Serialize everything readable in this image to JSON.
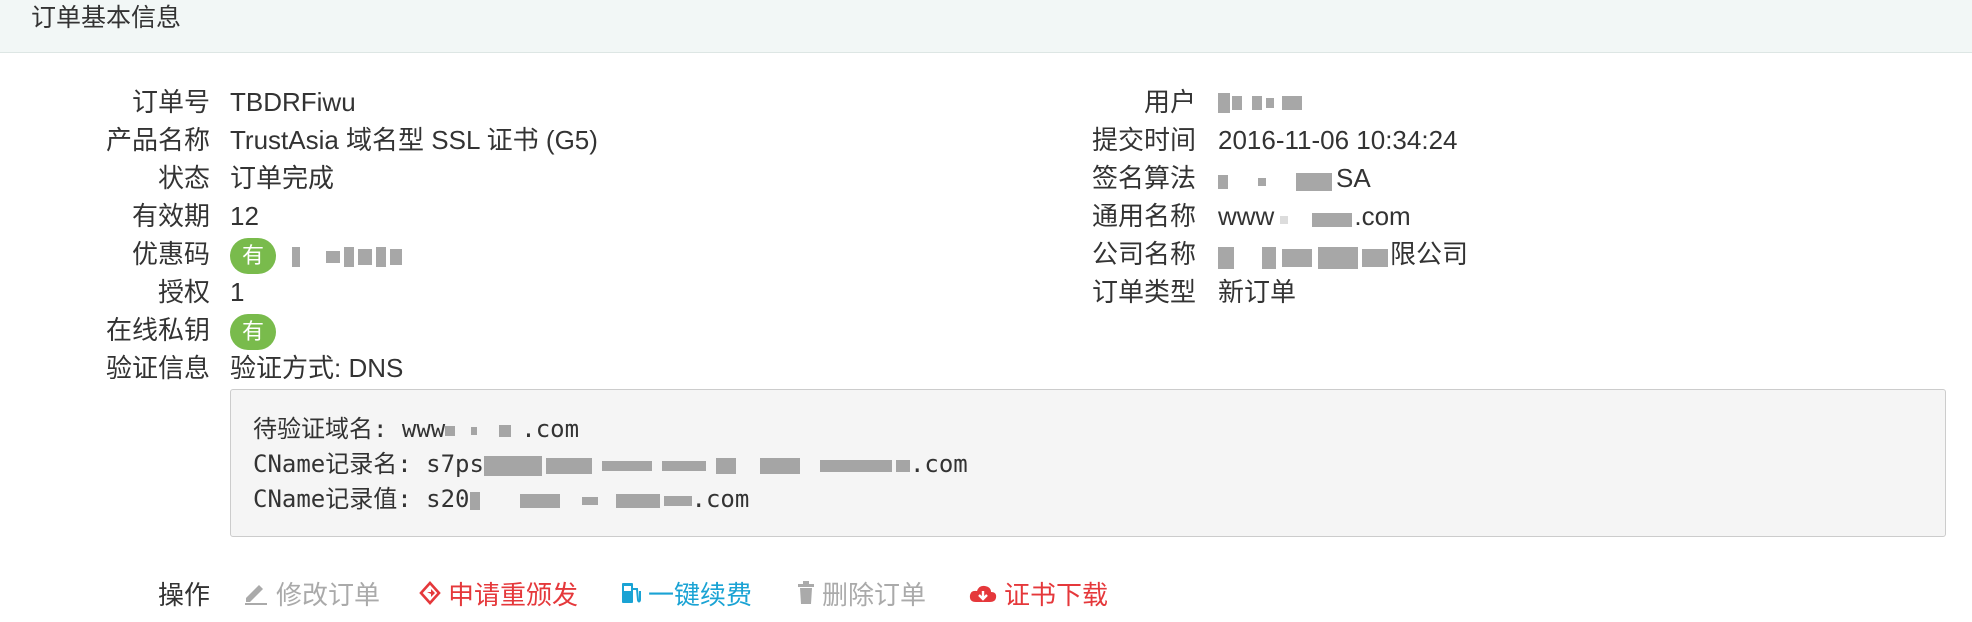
{
  "panel": {
    "title": "订单基本信息"
  },
  "left_fields": {
    "order_no": {
      "label": "订单号",
      "value": "TBDRFiwu"
    },
    "product": {
      "label": "产品名称",
      "value": "TrustAsia 域名型 SSL 证书 (G5)"
    },
    "status": {
      "label": "状态",
      "value": "订单完成"
    },
    "validity": {
      "label": "有效期",
      "value": "12"
    },
    "coupon": {
      "label": "优惠码",
      "badge": "有"
    },
    "license": {
      "label": "授权",
      "value": "1"
    },
    "online_key": {
      "label": "在线私钥",
      "badge": "有"
    },
    "verify": {
      "label": "验证信息",
      "value": "验证方式: DNS"
    }
  },
  "right_fields": {
    "user": {
      "label": "用户"
    },
    "submit_time": {
      "label": "提交时间",
      "value": "2016-11-06 10:34:24"
    },
    "sign_algo": {
      "label": "签名算法",
      "value_suffix": "SA"
    },
    "common_name": {
      "label": "通用名称",
      "value_prefix": "www",
      "value_suffix": ".com"
    },
    "company": {
      "label": "公司名称",
      "value_suffix": "限公司"
    },
    "order_type": {
      "label": "订单类型",
      "value": "新订单"
    }
  },
  "verification_box": {
    "domain_label": "待验证域名: ",
    "domain_prefix": "www",
    "domain_suffix": ".com",
    "cname_name_label": "CName记录名: ",
    "cname_name_prefix": "s7ps",
    "cname_name_suffix": ".com",
    "cname_value_label": "CName记录值: ",
    "cname_value_prefix": "s20",
    "cname_value_suffix": ".com"
  },
  "actions": {
    "label": "操作",
    "edit": "修改订单",
    "reissue": "申请重颁发",
    "renew": "一键续费",
    "delete": "删除订单",
    "download": "证书下载"
  },
  "colors": {
    "badge_green": "#79bb4c",
    "action_disabled": "#aaaaaa",
    "action_red": "#e5383b",
    "action_blue": "#1aa3d4"
  },
  "icons": {
    "edit": "pencil-icon",
    "reissue": "reissue-icon",
    "renew": "fuel-pump-icon",
    "delete": "trash-icon",
    "download": "cloud-download-icon"
  }
}
